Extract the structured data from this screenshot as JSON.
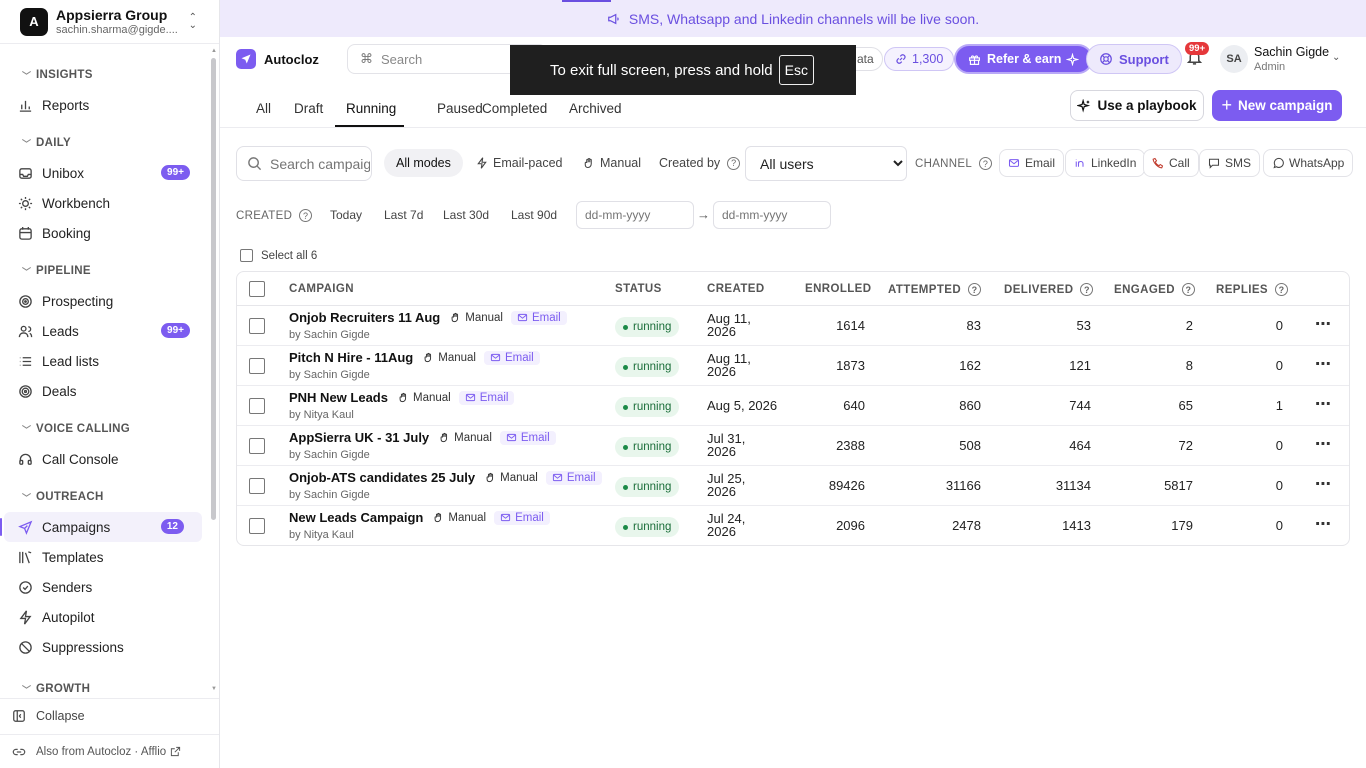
{
  "org": {
    "avatar": "A",
    "name": "Appsierra Group",
    "email": "sachin.sharma@gigde...."
  },
  "nav": {
    "sections": [
      {
        "title": "INSIGHTS",
        "items": [
          {
            "label": "Reports",
            "icon": "bar-chart-icon"
          }
        ]
      },
      {
        "title": "DAILY",
        "items": [
          {
            "label": "Unibox",
            "icon": "inbox-icon",
            "badge": "99+"
          },
          {
            "label": "Workbench",
            "icon": "sun-icon"
          },
          {
            "label": "Booking",
            "icon": "calendar-icon"
          }
        ]
      },
      {
        "title": "PIPELINE",
        "items": [
          {
            "label": "Prospecting",
            "icon": "target-icon"
          },
          {
            "label": "Leads",
            "icon": "users-icon",
            "badge": "99+"
          },
          {
            "label": "Lead lists",
            "icon": "list-icon"
          },
          {
            "label": "Deals",
            "icon": "deal-icon"
          }
        ]
      },
      {
        "title": "VOICE CALLING",
        "items": [
          {
            "label": "Call Console",
            "icon": "headset-icon"
          }
        ]
      },
      {
        "title": "OUTREACH",
        "items": [
          {
            "label": "Campaigns",
            "icon": "send-icon",
            "badge": "12",
            "active": true
          },
          {
            "label": "Templates",
            "icon": "templates-icon"
          },
          {
            "label": "Senders",
            "icon": "check-circle-icon"
          },
          {
            "label": "Autopilot",
            "icon": "bolt-icon"
          },
          {
            "label": "Suppressions",
            "icon": "ban-icon"
          }
        ]
      },
      {
        "title": "GROWTH",
        "items": []
      }
    ],
    "collapse": "Collapse",
    "also_from": "Also from Autocloz · Afflio"
  },
  "banner": {
    "text": "SMS, Whatsapp and Linkedin channels will be live soon."
  },
  "topbar": {
    "brand": "Autocloz",
    "search_placeholder": "Search",
    "data_pill": "ata",
    "credits": "1,300",
    "refer": "Refer & earn",
    "support": "Support",
    "notif_badge": "99+",
    "user_initials": "SA",
    "user_name": "Sachin Gigde",
    "user_role": "Admin"
  },
  "toast": {
    "text": "To exit full screen, press and hold",
    "key": "Esc"
  },
  "tabs": {
    "items": [
      "All",
      "Draft",
      "Running",
      "Paused",
      "Completed",
      "Archived"
    ],
    "active": "Running"
  },
  "actions": {
    "playbook": "Use a playbook",
    "new_campaign": "New campaign"
  },
  "filters": {
    "search_placeholder": "Search campaigns",
    "modes": [
      "All modes",
      "Email-paced",
      "Manual"
    ],
    "created_by_label": "Created by",
    "created_by_value": "All users",
    "channel_label": "CHANNEL",
    "channels": [
      "Email",
      "LinkedIn",
      "Call",
      "SMS",
      "WhatsApp"
    ],
    "created_label": "CREATED",
    "date_ranges": [
      "Today",
      "Last 7d",
      "Last 30d",
      "Last 90d"
    ],
    "date_placeholder": "dd-mm-yyyy",
    "select_all": "Select all 6"
  },
  "table": {
    "columns": [
      "CAMPAIGN",
      "STATUS",
      "CREATED",
      "ENROLLED",
      "ATTEMPTED",
      "DELIVERED",
      "ENGAGED",
      "REPLIES"
    ],
    "rows": [
      {
        "name": "Onjob Recruiters 11 Aug",
        "mode": "Manual",
        "channel": "Email",
        "by": "by Sachin Gigde",
        "status": "running",
        "created": "Aug 11, 2026",
        "enrolled": "1614",
        "attempted": "83",
        "delivered": "53",
        "engaged": "2",
        "replies": "0"
      },
      {
        "name": "Pitch N Hire - 11Aug",
        "mode": "Manual",
        "channel": "Email",
        "by": "by Sachin Gigde",
        "status": "running",
        "created": "Aug 11, 2026",
        "enrolled": "1873",
        "attempted": "162",
        "delivered": "121",
        "engaged": "8",
        "replies": "0"
      },
      {
        "name": "PNH New Leads",
        "mode": "Manual",
        "channel": "Email",
        "by": "by Nitya Kaul",
        "status": "running",
        "created": "Aug 5, 2026",
        "enrolled": "640",
        "attempted": "860",
        "delivered": "744",
        "engaged": "65",
        "replies": "1"
      },
      {
        "name": "AppSierra UK - 31 July",
        "mode": "Manual",
        "channel": "Email",
        "by": "by Sachin Gigde",
        "status": "running",
        "created": "Jul 31, 2026",
        "enrolled": "2388",
        "attempted": "508",
        "delivered": "464",
        "engaged": "72",
        "replies": "0"
      },
      {
        "name": "Onjob-ATS candidates 25 July",
        "mode": "Manual",
        "channel": "Email",
        "by": "by Sachin Gigde",
        "status": "running",
        "created": "Jul 25, 2026",
        "enrolled": "89426",
        "attempted": "31166",
        "delivered": "31134",
        "engaged": "5817",
        "replies": "0"
      },
      {
        "name": "New Leads Campaign",
        "mode": "Manual",
        "channel": "Email",
        "by": "by Nitya Kaul",
        "status": "running",
        "created": "Jul 24, 2026",
        "enrolled": "2096",
        "attempted": "2478",
        "delivered": "1413",
        "engaged": "179",
        "replies": "0"
      }
    ]
  }
}
